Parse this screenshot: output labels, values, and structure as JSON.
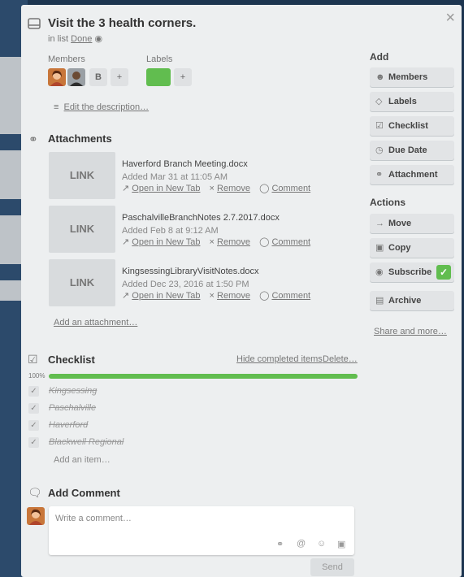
{
  "card": {
    "title": "Visit the 3 health corners.",
    "in_list_prefix": "in list",
    "list_name": "Done",
    "close_glyph": "×"
  },
  "members": {
    "label": "Members",
    "initial": "B",
    "add": "+"
  },
  "labels": {
    "label": "Labels",
    "add": "+",
    "green_color": "#61bd4f"
  },
  "description": {
    "edit_label": "Edit the description…"
  },
  "attachments": {
    "title": "Attachments",
    "thumb_text": "LINK",
    "open_label": "Open in New Tab",
    "remove_label": "Remove",
    "comment_label": "Comment",
    "items": [
      {
        "name": "Haverford Branch Meeting.docx",
        "added": "Added Mar 31 at 11:05 AM"
      },
      {
        "name": "PaschalvilleBranchNotes 2.7.2017.docx",
        "added": "Added Feb 8 at 9:12 AM"
      },
      {
        "name": "KingsessingLibraryVisitNotes.docx",
        "added": "Added Dec 23, 2016 at 1:50 PM"
      }
    ],
    "add_label": "Add an attachment…"
  },
  "checklist": {
    "title": "Checklist",
    "hide_label": "Hide completed items",
    "delete_label": "Delete…",
    "progress_text": "100%",
    "progress_value": 100,
    "items": [
      {
        "text": "Kingsessing",
        "checked": true
      },
      {
        "text": "Paschalville",
        "checked": true
      },
      {
        "text": "Haverford",
        "checked": true
      },
      {
        "text": "Blackwell Regional",
        "checked": true
      }
    ],
    "add_item_label": "Add an item…"
  },
  "comment": {
    "title": "Add Comment",
    "placeholder": "Write a comment…",
    "send_label": "Send"
  },
  "sidebar": {
    "add_heading": "Add",
    "add_buttons": [
      {
        "label": "Members",
        "icon": "person-icon"
      },
      {
        "label": "Labels",
        "icon": "tag-icon"
      },
      {
        "label": "Checklist",
        "icon": "checklist-icon"
      },
      {
        "label": "Due Date",
        "icon": "clock-icon"
      },
      {
        "label": "Attachment",
        "icon": "paperclip-icon"
      }
    ],
    "actions_heading": "Actions",
    "action_buttons": [
      {
        "label": "Move",
        "icon": "arrow-right-icon"
      },
      {
        "label": "Copy",
        "icon": "copy-icon"
      },
      {
        "label": "Subscribe",
        "icon": "eye-icon"
      },
      {
        "label": "Archive",
        "icon": "archive-icon"
      }
    ],
    "share_label": "Share and more…"
  }
}
